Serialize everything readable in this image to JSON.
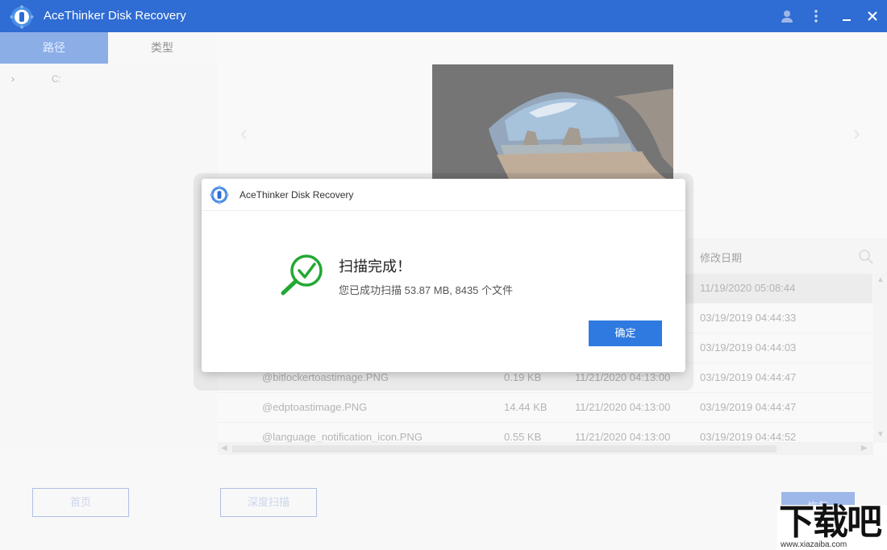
{
  "window": {
    "title": "AceThinker Disk Recovery"
  },
  "tabs": [
    {
      "label": "路径",
      "active": true
    },
    {
      "label": "类型",
      "active": false
    }
  ],
  "sidebar": {
    "tree": [
      {
        "label": "C:"
      }
    ]
  },
  "table": {
    "column_modified": "修改日期",
    "rows": [
      {
        "name": "",
        "size": "",
        "created": "",
        "modified": "11/19/2020 05:08:44",
        "selected": true
      },
      {
        "name": "",
        "size": "",
        "created": "",
        "modified": "03/19/2019 04:44:33"
      },
      {
        "name": "",
        "size": "",
        "created": "",
        "modified": "03/19/2019 04:44:03"
      },
      {
        "name": "@bitlockertoastimage.PNG",
        "size": "0.19 KB",
        "created": "11/21/2020 04:13:00",
        "modified": "03/19/2019 04:44:47"
      },
      {
        "name": "@edptoastimage.PNG",
        "size": "14.44 KB",
        "created": "11/21/2020 04:13:00",
        "modified": "03/19/2019 04:44:47"
      },
      {
        "name": "@language_notification_icon.PNG",
        "size": "0.55 KB",
        "created": "11/21/2020 04:13:00",
        "modified": "03/19/2019 04:44:52"
      }
    ]
  },
  "bottom": {
    "home_label": "首页",
    "deep_scan_label": "深度扫描",
    "recover_label": "恢复"
  },
  "dialog": {
    "title": "AceThinker Disk Recovery",
    "heading": "扫描完成！",
    "message": "您已成功扫描 53.87 MB, 8435 个文件",
    "ok_label": "确定"
  },
  "watermark": {
    "big": "下载吧",
    "small": "www.xiazaiba.com"
  },
  "colors": {
    "brand": "#2f6cd3",
    "ok_button": "#2f7ae0",
    "success": "#22a833"
  }
}
